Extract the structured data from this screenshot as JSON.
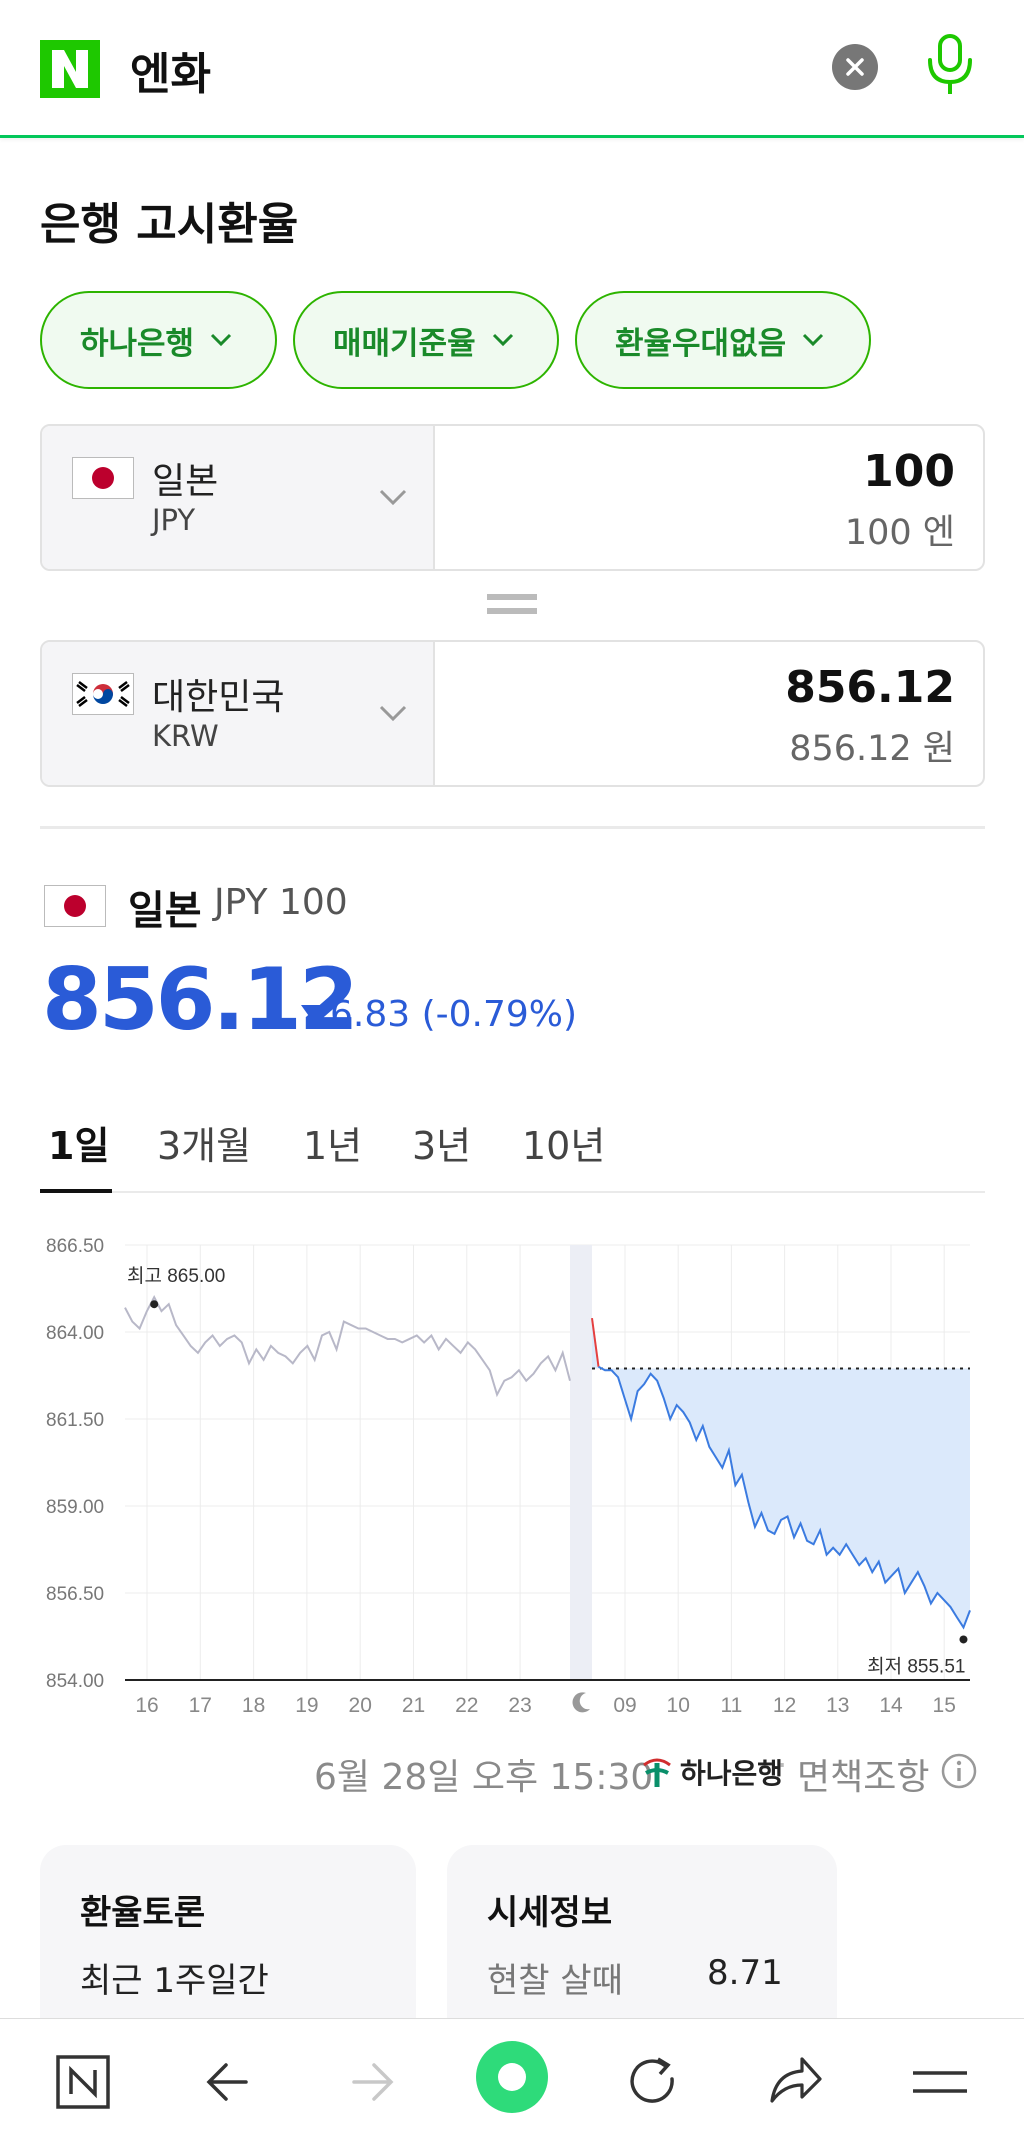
{
  "search": {
    "query": "엔화"
  },
  "section_title": "은행 고시환율",
  "filters": [
    {
      "label": "하나은행"
    },
    {
      "label": "매매기준율"
    },
    {
      "label": "환율우대없음"
    }
  ],
  "converter": {
    "from": {
      "country": "일본",
      "code": "JPY",
      "value": "100",
      "unit_text": "100 엔"
    },
    "to": {
      "country": "대한민국",
      "code": "KRW",
      "value": "856.12",
      "unit_text": "856.12 원"
    }
  },
  "rate": {
    "country": "일본",
    "code": "JPY 100",
    "value": "856.12",
    "change": "6.83 (-0.79%)",
    "direction": "down",
    "color": "#2a5bd7"
  },
  "tabs": [
    {
      "label": "1일",
      "active": true
    },
    {
      "label": "3개월",
      "active": false
    },
    {
      "label": "1년",
      "active": false
    },
    {
      "label": "3년",
      "active": false
    },
    {
      "label": "10년",
      "active": false
    }
  ],
  "chart_data": {
    "type": "line",
    "y_ticks": [
      "866.50",
      "864.00",
      "861.50",
      "859.00",
      "856.50",
      "854.00"
    ],
    "ylim": [
      854.0,
      866.5
    ],
    "x_ticks_prev": [
      "16",
      "17",
      "18",
      "19",
      "20",
      "21",
      "22",
      "23"
    ],
    "x_ticks_today": [
      "09",
      "10",
      "11",
      "12",
      "13",
      "14",
      "15"
    ],
    "high_label": "최고 865.00",
    "high_value": 865.0,
    "low_label": "최저 855.51",
    "low_value": 855.51,
    "baseline": 862.95,
    "series": [
      {
        "period": "previous",
        "color": "#b8b8c8",
        "values": [
          864.7,
          864.3,
          864.1,
          864.6,
          865.0,
          864.6,
          864.8,
          864.2,
          863.9,
          863.6,
          863.4,
          863.7,
          863.9,
          863.6,
          863.8,
          863.9,
          863.7,
          863.1,
          863.5,
          863.2,
          863.6,
          863.4,
          863.3,
          863.1,
          863.4,
          863.6,
          863.2,
          863.9,
          864.0,
          863.5,
          864.3,
          864.2,
          864.1,
          864.1,
          864.0,
          863.9,
          863.8,
          863.8,
          863.7,
          863.8,
          863.9,
          863.7,
          863.9,
          863.5,
          863.8,
          863.6,
          863.4,
          863.7,
          863.5,
          863.2,
          862.9,
          862.2,
          862.6,
          862.7,
          862.9,
          862.6,
          862.8,
          863.1,
          863.3,
          862.9,
          863.4,
          862.6
        ]
      },
      {
        "period": "today",
        "color": "#3b7be0",
        "values": [
          864.4,
          863.0,
          862.9,
          862.9,
          862.7,
          862.1,
          861.5,
          862.3,
          862.5,
          862.8,
          862.6,
          862.1,
          861.5,
          861.9,
          861.7,
          861.4,
          860.9,
          861.3,
          860.7,
          860.4,
          860.1,
          860.6,
          859.6,
          859.9,
          859.1,
          858.4,
          858.8,
          858.3,
          858.2,
          858.6,
          858.7,
          858.1,
          858.5,
          858.0,
          857.9,
          858.3,
          857.6,
          857.8,
          857.6,
          857.9,
          857.6,
          857.3,
          857.5,
          857.1,
          857.4,
          856.8,
          857.0,
          857.2,
          856.5,
          856.8,
          857.1,
          856.7,
          856.2,
          856.5,
          856.3,
          856.1,
          855.8,
          855.51,
          856.0
        ]
      }
    ]
  },
  "footer": {
    "timestamp": "6월 28일 오후 15:30",
    "bank": "하나은행",
    "disclaimer": "면책조항"
  },
  "cards": {
    "discussion": {
      "title": "환율토론",
      "text": "최근 1주일간"
    },
    "market_info": {
      "title": "시세정보",
      "label": "현찰 살때",
      "value": "8.71"
    }
  },
  "icons": {
    "header": [
      "n-logo-icon",
      "clear-icon",
      "mic-icon"
    ],
    "bottom": [
      "home-n-icon",
      "back-arrow-icon",
      "forward-arrow-icon",
      "green-dot-icon",
      "refresh-icon",
      "share-icon",
      "menu-icon"
    ]
  }
}
